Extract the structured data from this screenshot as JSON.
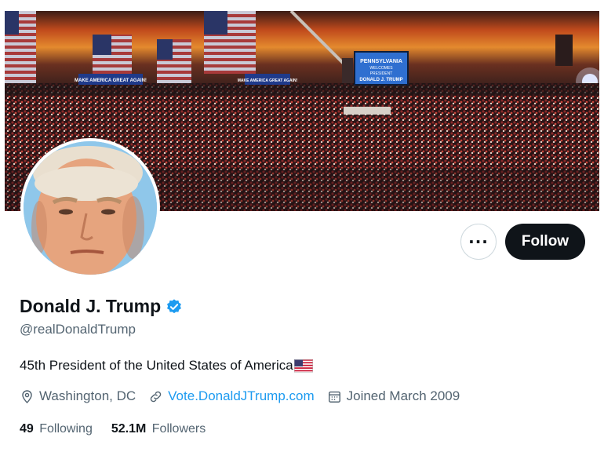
{
  "profile": {
    "name": "Donald J. Trump",
    "handle": "@realDonaldTrump",
    "bio": "45th President of the United States of America",
    "location": "Washington, DC",
    "website": "Vote.DonaldJTrump.com",
    "joined": "Joined March 2009",
    "following_count": "49",
    "following_label": "Following",
    "followers_count": "52.1M",
    "followers_label": "Followers"
  },
  "actions": {
    "more_label": "···",
    "follow_label": "Follow"
  },
  "banner": {
    "sign_main": "PENNSYLVANIA",
    "sign_sub": "WELCOMES",
    "sign_sub2": "PRESIDENT",
    "sign_name": "DONALD J. TRUMP",
    "banner_left": "MAKE AMERICA GREAT AGAIN!",
    "banner_mid": "MAKE AMERICA GREAT AGAIN!"
  },
  "icons": {
    "verified": "verified-badge-icon",
    "flag": "us-flag-emoji",
    "location": "location-pin-icon",
    "link": "link-icon",
    "calendar": "calendar-icon"
  },
  "colors": {
    "verified": "#1d9bf0",
    "link": "#1d9bf0",
    "follow_bg": "#0f1419",
    "secondary_text": "#536471"
  }
}
